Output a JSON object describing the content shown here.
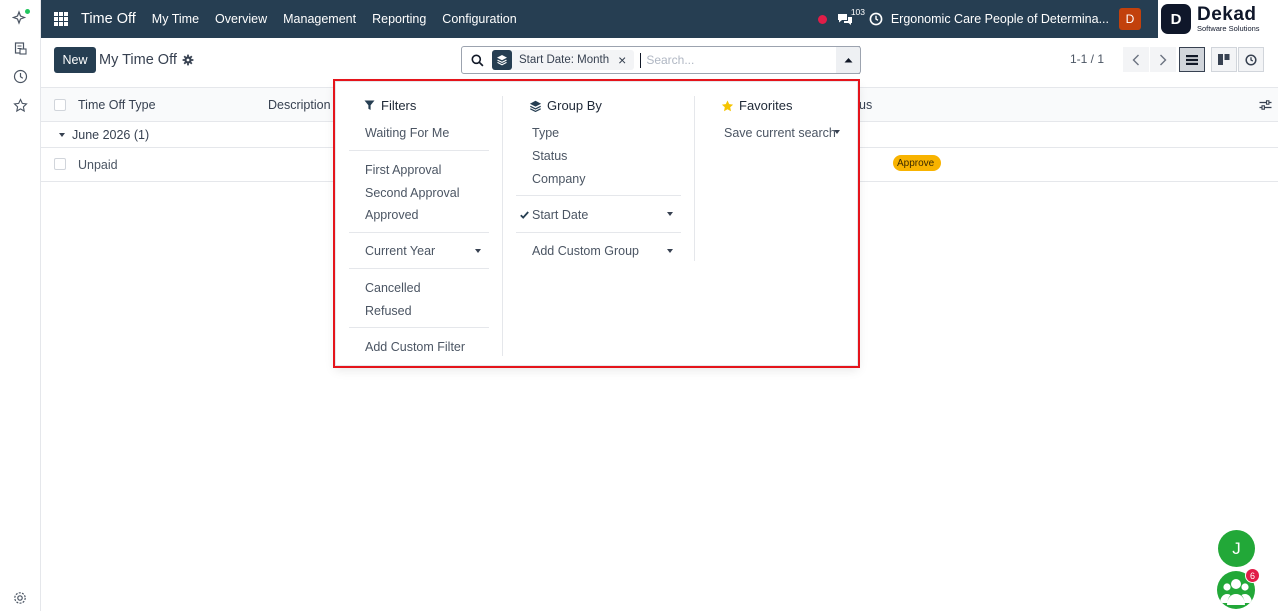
{
  "navbar": {
    "app_name": "Time Off",
    "menu": [
      "My Time",
      "Overview",
      "Management",
      "Reporting",
      "Configuration"
    ],
    "chat_count": "103",
    "company": "Ergonomic Care People of Determina...",
    "user_initial": "D"
  },
  "logo": {
    "name": "Dekad",
    "tagline": "Software Solutions",
    "mark": "D"
  },
  "control_panel": {
    "new_label": "New",
    "title": "My Time Off",
    "search": {
      "facet_label": "Start Date: Month",
      "placeholder": "Search..."
    },
    "pager": "1-1 / 1"
  },
  "list": {
    "columns": {
      "type": "Time Off Type",
      "description": "Description",
      "status_tail": "us"
    },
    "group_label": "June 2026 (1)",
    "rows": [
      {
        "type": "Unpaid",
        "status": "To Approve",
        "status_visible": "Approve",
        "status_color": "#f8b300"
      }
    ]
  },
  "dropdown": {
    "filters": {
      "title": "Filters",
      "items": [
        "Waiting For Me",
        "First Approval",
        "Second Approval",
        "Approved",
        "Current Year",
        "Cancelled",
        "Refused",
        "Add Custom Filter"
      ]
    },
    "group_by": {
      "title": "Group By",
      "items": [
        "Type",
        "Status",
        "Company",
        "Start Date",
        "Add Custom Group"
      ]
    },
    "favorites": {
      "title": "Favorites",
      "items": [
        "Save current search"
      ]
    },
    "highlight_color": "#e5141b"
  },
  "floating": {
    "user_initial": "J",
    "badge_count": "6"
  },
  "colors": {
    "navbar": "#263e52",
    "accent_green": "#22a838",
    "badge_red": "#e11d48",
    "favorite_star": "#f5c400"
  }
}
